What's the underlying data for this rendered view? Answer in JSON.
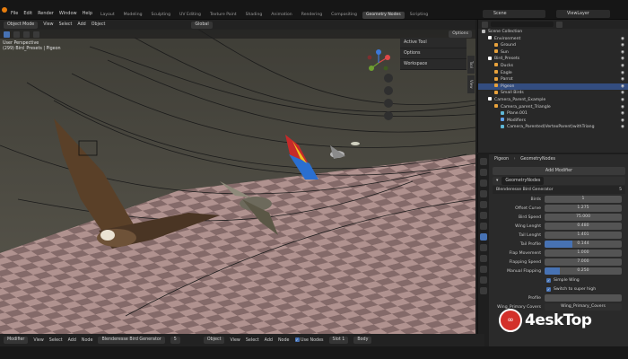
{
  "menu": [
    "File",
    "Edit",
    "Render",
    "Window",
    "Help"
  ],
  "workspaces": [
    "Layout",
    "Modeling",
    "Sculpting",
    "UV Editing",
    "Texture Paint",
    "Shading",
    "Animation",
    "Rendering",
    "Compositing",
    "Geometry Nodes",
    "Scripting"
  ],
  "active_workspace": "Geometry Nodes",
  "scene": "Scene",
  "view_layer": "ViewLayer",
  "viewport": {
    "mode": "Object Mode",
    "menus": [
      "View",
      "Select",
      "Add",
      "Object"
    ],
    "orientation": "Global",
    "options": "Options",
    "info_line1": "User Perspective",
    "info_line2": "(299) Bird_Presets | Pigeon",
    "npanel": [
      "Active Tool",
      "Options",
      "Workspace"
    ],
    "side_tabs": [
      "Tool",
      "View"
    ]
  },
  "outliner": {
    "rows": [
      {
        "label": "Scene Collection",
        "indent": 0,
        "icon": "#bbbbbb",
        "selected": false
      },
      {
        "label": "Environment",
        "indent": 1,
        "icon": "#ffffff",
        "selected": false
      },
      {
        "label": "Ground",
        "indent": 2,
        "icon": "#e8a23c",
        "selected": false
      },
      {
        "label": "Sun",
        "indent": 2,
        "icon": "#e8a23c",
        "selected": false
      },
      {
        "label": "Bird_Presets",
        "indent": 1,
        "icon": "#ffffff",
        "selected": false
      },
      {
        "label": "Ducks",
        "indent": 2,
        "icon": "#e8a23c",
        "selected": false
      },
      {
        "label": "Eagle",
        "indent": 2,
        "icon": "#e8a23c",
        "selected": false
      },
      {
        "label": "Parrot",
        "indent": 2,
        "icon": "#e8a23c",
        "selected": false
      },
      {
        "label": "Pigeon",
        "indent": 2,
        "icon": "#e8a23c",
        "selected": true
      },
      {
        "label": "Small Birds",
        "indent": 2,
        "icon": "#e8a23c",
        "selected": false
      },
      {
        "label": "Camera_Parent_Example",
        "indent": 1,
        "icon": "#ffffff",
        "selected": false
      },
      {
        "label": "Camera_parent_Triangle",
        "indent": 2,
        "icon": "#e8a23c",
        "selected": false
      },
      {
        "label": "Plane.001",
        "indent": 3,
        "icon": "#5fb7d6",
        "selected": false
      },
      {
        "label": "Modifiers",
        "indent": 3,
        "icon": "#5fa0e8",
        "selected": false
      },
      {
        "label": "Camera_Parented(VertexParent)withTriang",
        "indent": 3,
        "icon": "#5fb7d6",
        "selected": false
      }
    ]
  },
  "properties": {
    "breadcrumb_object": "Pigeon",
    "breadcrumb_modifier": "GeometryNodes",
    "add_modifier": "Add Modifier",
    "modifier_name": "GeometryNodes",
    "node_group": "Blenderesse Bird Generator",
    "node_group_users": "5",
    "fields": [
      {
        "label": "Birds",
        "value": "1",
        "fill": 0
      },
      {
        "label": "Offset Curve",
        "value": "1.275",
        "fill": 0
      },
      {
        "label": "Bird Speed",
        "value": "75.000",
        "fill": 0
      },
      {
        "label": "Wing Lenght",
        "value": "0.480",
        "fill": 0
      },
      {
        "label": "Tail Lenght",
        "value": "1.401",
        "fill": 0
      },
      {
        "label": "Tail Profile",
        "value": "0.144",
        "fill": 0.36
      },
      {
        "label": "Flap Movement",
        "value": "1.000",
        "fill": 0
      },
      {
        "label": "Flapping Speed",
        "value": "7.000",
        "fill": 0
      },
      {
        "label": "Manual Flapping",
        "value": "0.250",
        "fill": 0.2
      }
    ],
    "checks": [
      "Simple Wing",
      "Switch to super high"
    ],
    "profile_label": "Profile",
    "bottom_fields": [
      "Wing_Primary Covers",
      "Wing_Primary_Covers"
    ]
  },
  "bottombar": {
    "editor": "Modifier",
    "menus": [
      "View",
      "Select",
      "Add",
      "Node"
    ],
    "node_group": "Blenderesse Bird Generator",
    "users": "5",
    "object_menu": "Object",
    "menus2": [
      "View",
      "Select",
      "Add",
      "Node"
    ],
    "use_nodes": "Use Nodes",
    "slot": "Slot 1",
    "body": "Body"
  },
  "watermark": {
    "text": "4eskTop",
    "symbol": "∞"
  },
  "colors": {
    "accent": "#4772b3",
    "selected_row": "#334d80",
    "ground_tile_a": "#c9a9a5",
    "ground_tile_b": "#8a6e6c"
  }
}
